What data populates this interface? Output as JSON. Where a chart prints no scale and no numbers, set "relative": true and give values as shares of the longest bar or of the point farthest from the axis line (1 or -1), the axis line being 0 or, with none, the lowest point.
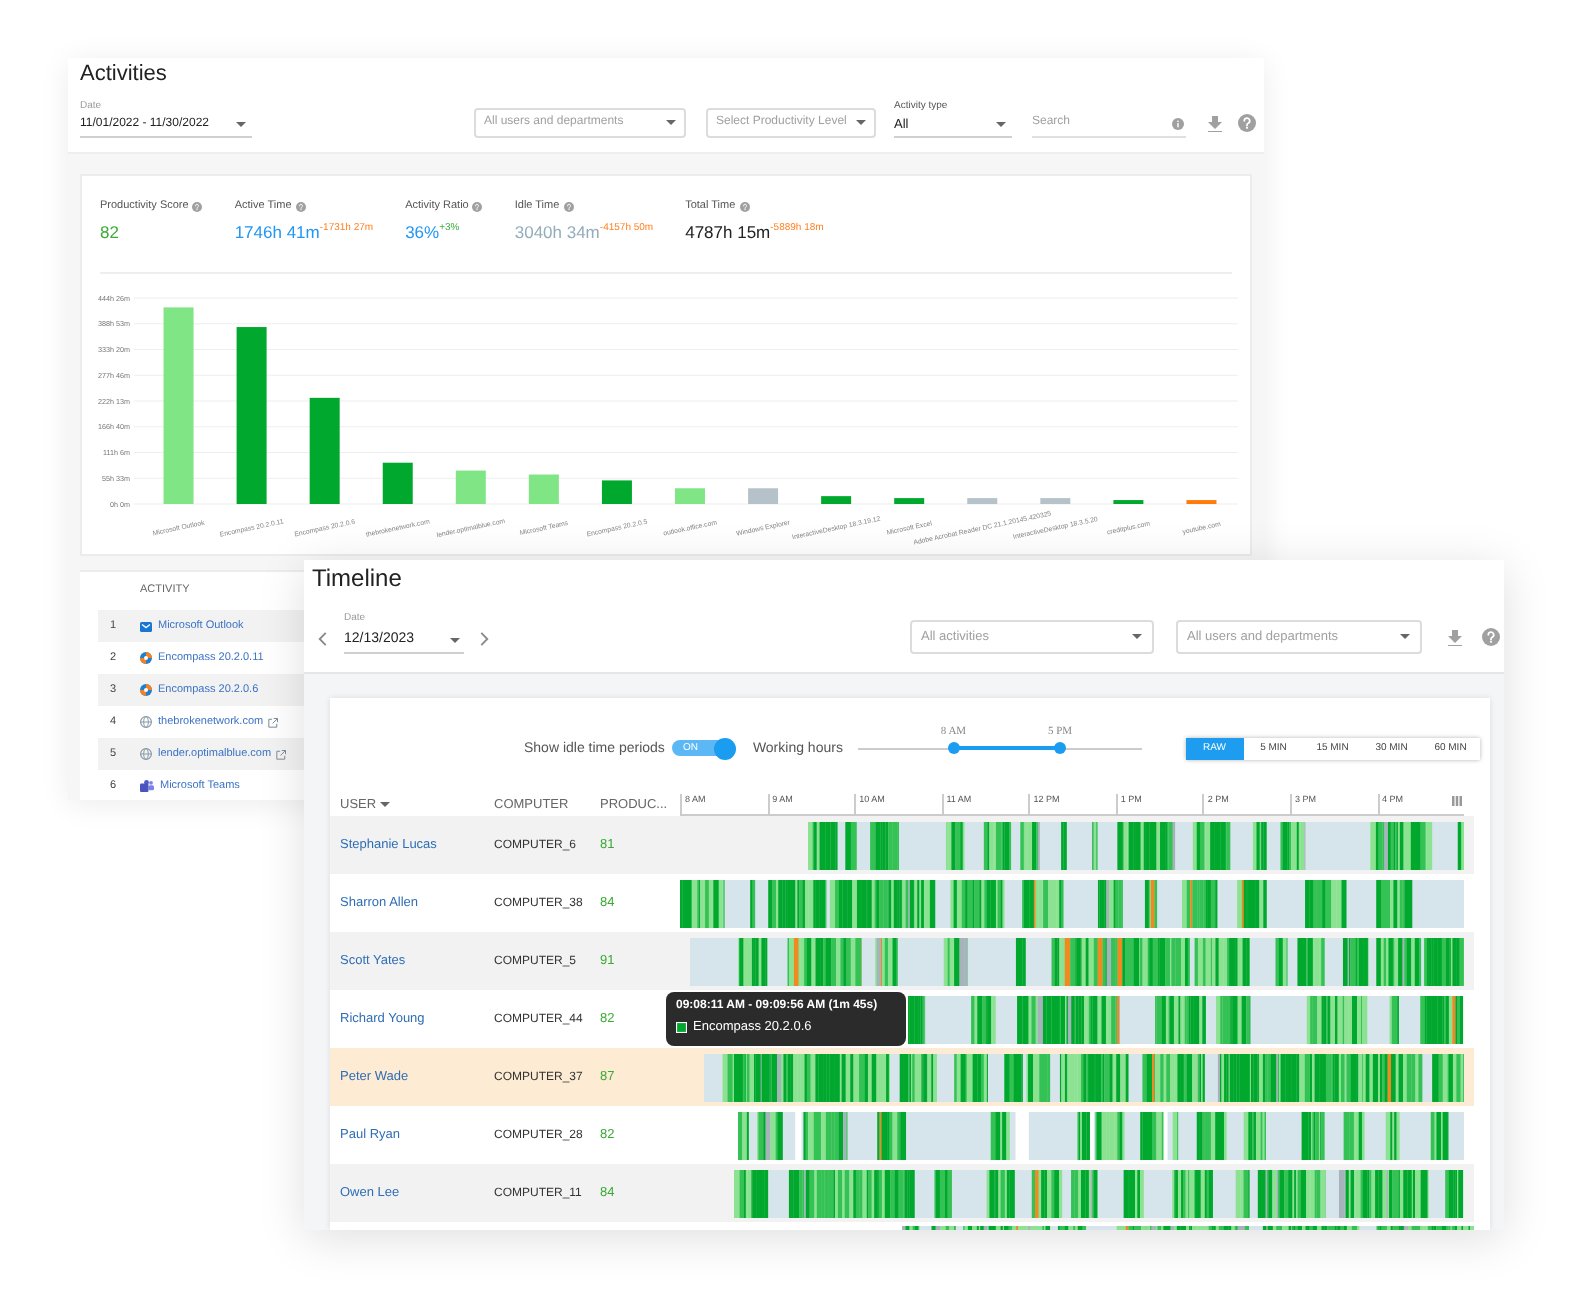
{
  "activities": {
    "title": "Activities",
    "date": {
      "label": "Date",
      "value": "11/01/2022 - 11/30/2022"
    },
    "users_filter": {
      "placeholder": "All users and departments"
    },
    "productivity_filter": {
      "placeholder": "Select Productivity Level"
    },
    "activity_type": {
      "label": "Activity type",
      "value": "All"
    },
    "search": {
      "placeholder": "Search"
    },
    "stats": [
      {
        "label": "Productivity Score",
        "value": "82",
        "color": "#3aaa35"
      },
      {
        "label": "Active Time",
        "value": "1746h 41m",
        "color": "#2196f3",
        "delta": {
          "text": "-1731h 27m",
          "negative": true
        }
      },
      {
        "label": "Activity Ratio",
        "value": "36%",
        "color": "#2196f3",
        "delta": {
          "text": "+3%",
          "negative": false
        }
      },
      {
        "label": "Idle Time",
        "value": "3040h 34m",
        "color": "#94acbb",
        "delta": {
          "text": "-4157h 50m",
          "negative": true
        }
      },
      {
        "label": "Total Time",
        "value": "4787h 15m",
        "color": "#222222",
        "delta": {
          "text": "-5889h 18m",
          "negative": true
        }
      }
    ],
    "y_axis_labels": [
      "444h 26m",
      "388h 53m",
      "333h 20m",
      "277h 46m",
      "222h 13m",
      "166h 40m",
      "111h 6m",
      "55h 33m",
      "0h 0m"
    ],
    "chart_data": {
      "type": "bar",
      "relative": true,
      "categories": [
        "Microsoft Outlook",
        "Encompass 20.2.0.11",
        "Encompass 20.2.0.6",
        "thebrokenetwork.com",
        "lender.optimalblue.com",
        "Microsoft Teams",
        "Encompass 20.2.0.5",
        "outlook.office.com",
        "Windows Explorer",
        "InteractiveDesktop 18.3.19.12",
        "Microsoft Excel",
        "Adobe Acrobat Reader DC 21.1.20145.420325",
        "InteractiveDesktop 18.3.5.20",
        "creditplus.com",
        "youtube.com"
      ],
      "series": [
        {
          "color": "#00a82d",
          "values": [
            null,
            0.9,
            0.54,
            0.21,
            null,
            null,
            0.12,
            null,
            null,
            0.04,
            0.03,
            null,
            null,
            0.02,
            null
          ]
        },
        {
          "color": "#80e585",
          "values": [
            1,
            null,
            null,
            null,
            0.17,
            0.15,
            null,
            0.08,
            null,
            null,
            null,
            null,
            null,
            null,
            null
          ]
        },
        {
          "color": "#b6c2c9",
          "values": [
            null,
            null,
            null,
            null,
            null,
            null,
            null,
            null,
            0.08,
            null,
            null,
            0.03,
            0.03,
            null,
            null
          ]
        },
        {
          "color": "#ff7c0a",
          "values": [
            null,
            null,
            null,
            null,
            null,
            null,
            null,
            null,
            null,
            null,
            null,
            null,
            null,
            null,
            0.02
          ]
        }
      ],
      "stacked": true
    },
    "table": {
      "column": "ACTIVITY",
      "rows": [
        {
          "rank": "1",
          "name": "Microsoft Outlook",
          "kind": "mail"
        },
        {
          "rank": "2",
          "name": "Encompass 20.2.0.11",
          "kind": "app"
        },
        {
          "rank": "3",
          "name": "Encompass 20.2.0.6",
          "kind": "app"
        },
        {
          "rank": "4",
          "name": "thebrokenetwork.com",
          "kind": "website"
        },
        {
          "rank": "5",
          "name": "lender.optimalblue.com",
          "kind": "website"
        },
        {
          "rank": "6",
          "name": "Microsoft Teams",
          "kind": "chat"
        }
      ]
    }
  },
  "timeline": {
    "title": "Timeline",
    "date": {
      "label": "Date",
      "value": "12/13/2023"
    },
    "activities_filter": {
      "placeholder": "All activities"
    },
    "users_filter": {
      "placeholder": "All users and departments"
    },
    "idle_toggle": {
      "label": "Show idle time periods",
      "text": "ON",
      "on": true
    },
    "working_hours": {
      "label": "Working hours",
      "thumbs": [
        {
          "label": "8 AM",
          "level": 0.333
        },
        {
          "label": "5 PM",
          "level": 0.708
        }
      ]
    },
    "intervals": [
      {
        "label": "RAW",
        "selected": true
      },
      {
        "label": "5 MIN",
        "selected": false
      },
      {
        "label": "15 MIN",
        "selected": false
      },
      {
        "label": "30 MIN",
        "selected": false
      },
      {
        "label": "60 MIN",
        "selected": false
      }
    ],
    "columns": [
      {
        "label": "USER",
        "sorted": true
      },
      {
        "label": "COMPUTER",
        "sorted": false
      },
      {
        "label": "PRODUC...",
        "sorted": false
      }
    ],
    "time_axis": [
      "8 AM",
      "9 AM",
      "10 AM",
      "11 AM",
      "12 PM",
      "1 PM",
      "2 PM",
      "3 PM",
      "4 PM"
    ],
    "rows": [
      {
        "user": "Stephanie Lucas",
        "computer": "COMPUTER_6",
        "productivity": "81",
        "selected": false
      },
      {
        "user": "Sharron Allen",
        "computer": "COMPUTER_38",
        "productivity": "84",
        "selected": false
      },
      {
        "user": "Scott Yates",
        "computer": "COMPUTER_5",
        "productivity": "91",
        "selected": false
      },
      {
        "user": "Richard Young",
        "computer": "COMPUTER_44",
        "productivity": "82",
        "selected": false
      },
      {
        "user": "Peter Wade",
        "computer": "COMPUTER_37",
        "productivity": "87",
        "selected": true
      },
      {
        "user": "Paul Ryan",
        "computer": "COMPUTER_28",
        "productivity": "82",
        "selected": false
      },
      {
        "user": "Owen Lee",
        "computer": "COMPUTER_11",
        "productivity": "84",
        "selected": false
      }
    ],
    "tooltip": {
      "time": "09:08:11 AM - 09:09:56 AM (1m 45s)",
      "activity": "Encompass 20.2.0.6"
    }
  }
}
